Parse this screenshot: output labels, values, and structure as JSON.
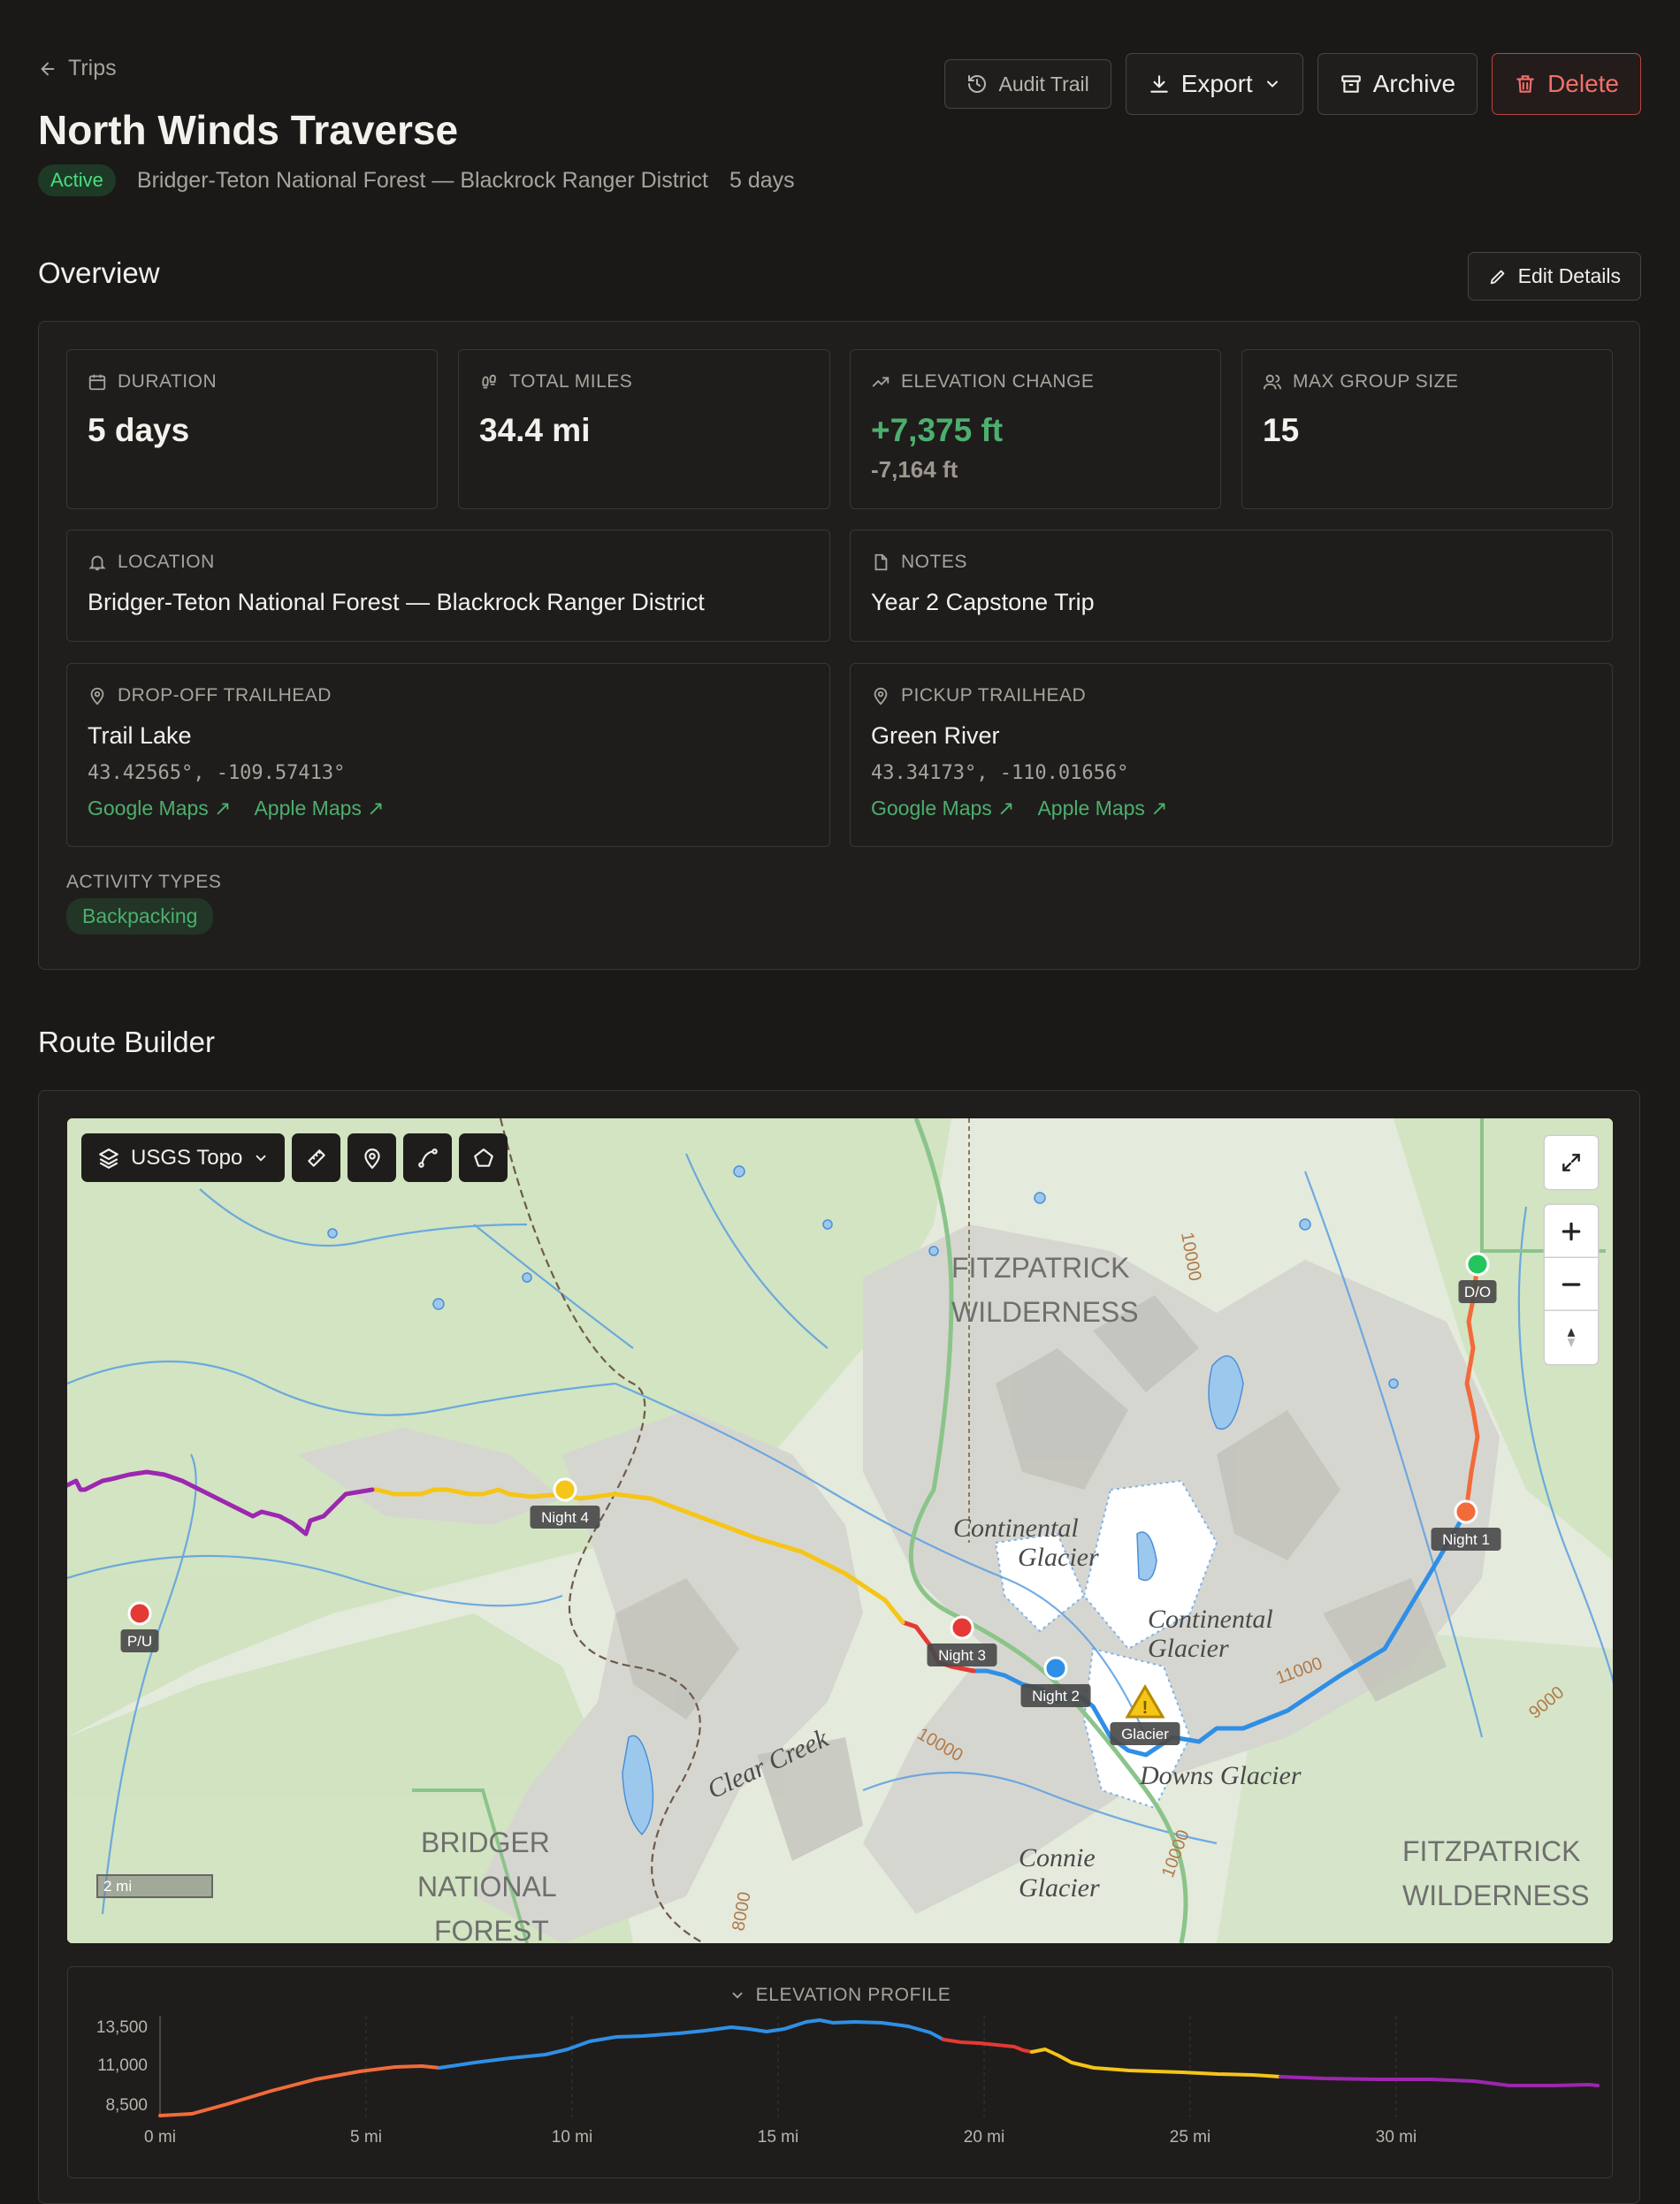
{
  "header": {
    "back_label": "Trips",
    "title": "North Winds Traverse",
    "status": "Active",
    "location": "Bridger-Teton National Forest — Blackrock Ranger District",
    "duration": "5 days",
    "actions": {
      "audit_trail": "Audit Trail",
      "export": "Export",
      "archive": "Archive",
      "delete": "Delete"
    }
  },
  "overview": {
    "title": "Overview",
    "edit_label": "Edit Details",
    "stats": {
      "duration": {
        "label": "DURATION",
        "value": "5 days"
      },
      "total_miles": {
        "label": "TOTAL MILES",
        "value": "34.4 mi"
      },
      "elevation": {
        "label": "ELEVATION CHANGE",
        "gain": "+7,375 ft",
        "loss": "-7,164 ft"
      },
      "group_size": {
        "label": "MAX GROUP SIZE",
        "value": "15"
      }
    },
    "location": {
      "label": "LOCATION",
      "value": "Bridger-Teton National Forest — Blackrock Ranger District"
    },
    "notes": {
      "label": "NOTES",
      "value": "Year 2 Capstone Trip"
    },
    "dropoff": {
      "label": "DROP-OFF TRAILHEAD",
      "name": "Trail Lake",
      "coords": "43.42565°, -109.57413°",
      "google": "Google Maps ↗",
      "apple": "Apple Maps ↗"
    },
    "pickup": {
      "label": "PICKUP TRAILHEAD",
      "name": "Green River",
      "coords": "43.34173°, -110.01656°",
      "google": "Google Maps ↗",
      "apple": "Apple Maps ↗"
    },
    "activity_label": "ACTIVITY TYPES",
    "activities": [
      "Backpacking"
    ]
  },
  "route_builder": {
    "title": "Route Builder",
    "layer": "USGS Topo",
    "scale": "2 mi",
    "map_text": {
      "fitz_north": [
        "FITZPATRICK",
        "WILDERNESS"
      ],
      "fitz_south": [
        "FITZPATRICK",
        "WILDERNESS"
      ],
      "continental_glacier_a": [
        "Continental",
        "Glacier"
      ],
      "continental_glacier_b": [
        "Continental",
        "Glacier"
      ],
      "downs_glacier": "Downs Glacier",
      "connie_glacier": [
        "Connie",
        "Glacier"
      ],
      "clear_creek": "Clear Creek",
      "bridger": [
        "BRIDGER",
        "NATIONAL",
        "FOREST"
      ]
    },
    "markers": {
      "dropoff": "D/O",
      "night1": "Night 1",
      "glacier": "Glacier",
      "night2": "Night 2",
      "night3": "Night 3",
      "night4": "Night 4",
      "pickup": "P/U"
    },
    "colors": {
      "day1": "#f26b3a",
      "day2": "#2f8fe6",
      "day3": "#e53935",
      "day4": "#f5c518",
      "day5": "#9c27b0"
    }
  },
  "elevation_profile": {
    "title": "ELEVATION PROFILE",
    "y_ticks": [
      "13,500",
      "11,000",
      "8,500"
    ],
    "x_ticks": [
      "0 mi",
      "5 mi",
      "10 mi",
      "15 mi",
      "20 mi",
      "25 mi",
      "30 mi"
    ]
  }
}
